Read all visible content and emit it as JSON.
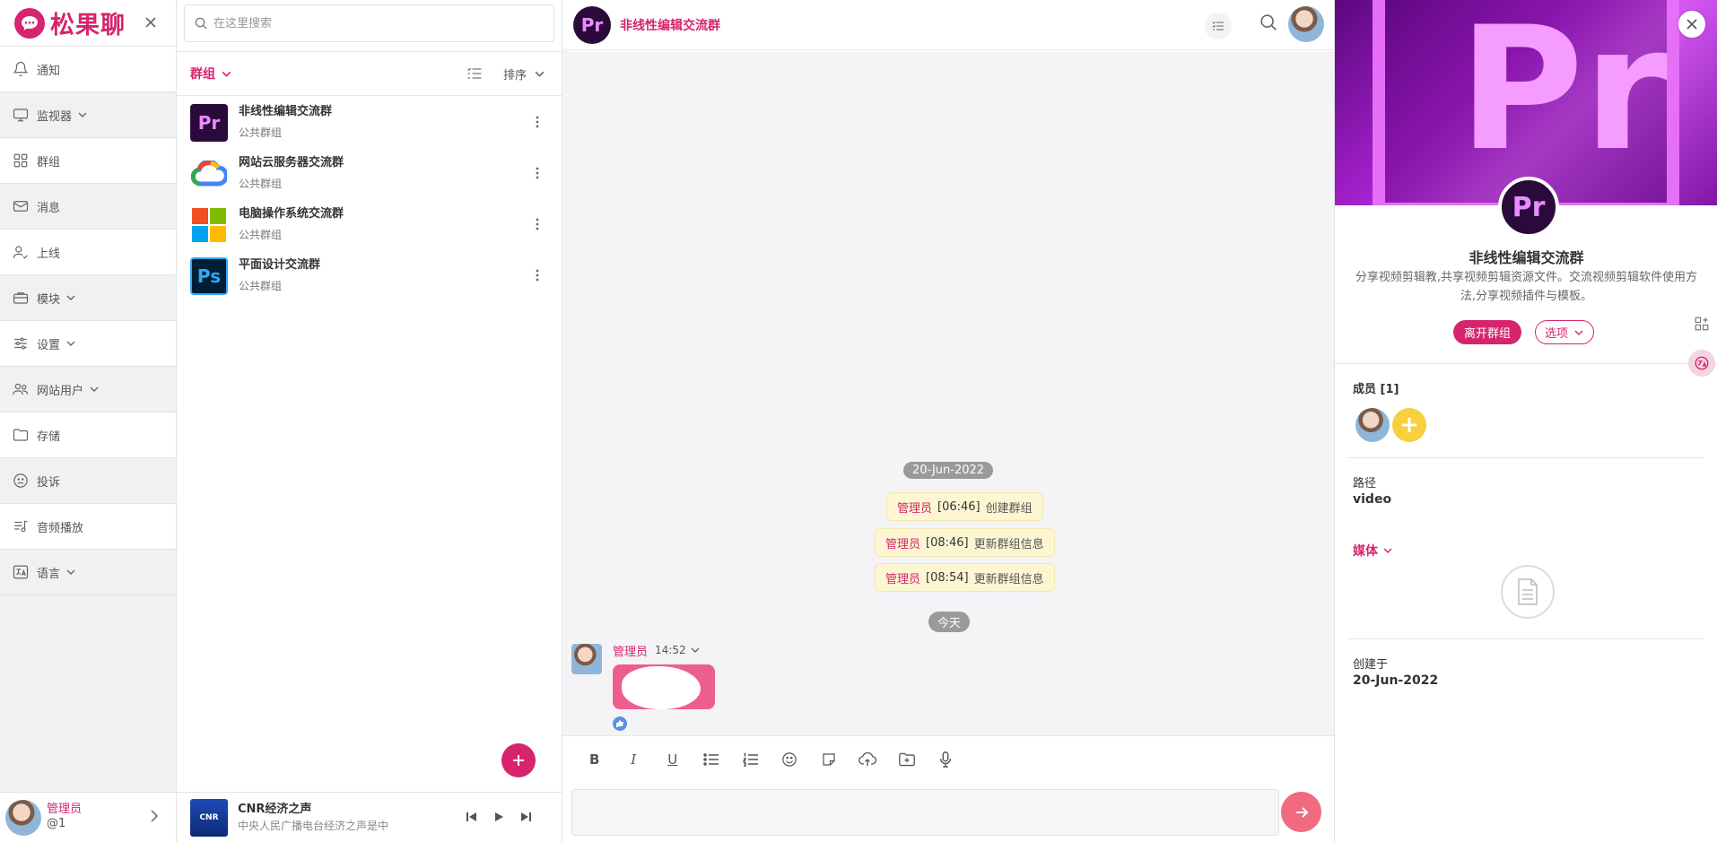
{
  "app": {
    "name": "松果聊"
  },
  "colors": {
    "accent": "#d6246e",
    "send": "#f06b80",
    "system_bg": "#fcf6d2"
  },
  "nav": {
    "items": [
      {
        "label": "通知",
        "icon": "bell-icon",
        "has_dropdown": false
      },
      {
        "label": "监视器",
        "icon": "monitor-icon",
        "has_dropdown": true
      },
      {
        "label": "群组",
        "icon": "grid-icon",
        "has_dropdown": false
      },
      {
        "label": "消息",
        "icon": "mail-icon",
        "has_dropdown": false
      },
      {
        "label": "上线",
        "icon": "user-check-icon",
        "has_dropdown": false
      },
      {
        "label": "模块",
        "icon": "briefcase-icon",
        "has_dropdown": true
      },
      {
        "label": "设置",
        "icon": "sliders-icon",
        "has_dropdown": true
      },
      {
        "label": "网站用户",
        "icon": "users-icon",
        "has_dropdown": true
      },
      {
        "label": "存储",
        "icon": "folder-icon",
        "has_dropdown": false
      },
      {
        "label": "投诉",
        "icon": "frown-icon",
        "has_dropdown": false
      },
      {
        "label": "音频播放",
        "icon": "music-list-icon",
        "has_dropdown": false
      },
      {
        "label": "语言",
        "icon": "translate-icon",
        "has_dropdown": true
      }
    ],
    "user": {
      "name": "管理员",
      "handle": "@1"
    }
  },
  "search": {
    "placeholder": "在这里搜索"
  },
  "group_list": {
    "tab_label": "群组",
    "sort_label": "排序",
    "items": [
      {
        "name": "非线性编辑交流群",
        "type": "公共群组",
        "icon_text": "Pr"
      },
      {
        "name": "网站云服务器交流群",
        "type": "公共群组",
        "icon_text": ""
      },
      {
        "name": "电脑操作系统交流群",
        "type": "公共群组",
        "icon_text": ""
      },
      {
        "name": "平面设计交流群",
        "type": "公共群组",
        "icon_text": "Ps"
      }
    ]
  },
  "player": {
    "title": "CNR经济之声",
    "subtitle": "中央人民广播电台经济之声是中",
    "cover_text": "CNR"
  },
  "chat": {
    "title": "非线性编辑交流群",
    "icon_text": "Pr",
    "date_pill": "20-Jun-2022",
    "system_messages": [
      {
        "who": "管理员",
        "time": "[06:46]",
        "text": "创建群组"
      },
      {
        "who": "管理员",
        "time": "[08:46]",
        "text": "更新群组信息"
      },
      {
        "who": "管理员",
        "time": "[08:54]",
        "text": "更新群组信息"
      }
    ],
    "today_pill": "今天",
    "message": {
      "author": "管理员",
      "time": "14:52"
    },
    "input_placeholder": ""
  },
  "info": {
    "cover_text": "Pr",
    "logo_text": "Pr",
    "name": "非线性编辑交流群",
    "description": "分享视频剪辑教,共享视频剪辑资源文件。交流视频剪辑软件使用方法,分享视频插件与模板。",
    "leave_label": "离开群组",
    "options_label": "选项",
    "members_label": "成员 [1]",
    "path_label": "路径",
    "path_value": "video",
    "media_label": "媒体",
    "created_label": "创建于",
    "created_value": "20-Jun-2022"
  }
}
